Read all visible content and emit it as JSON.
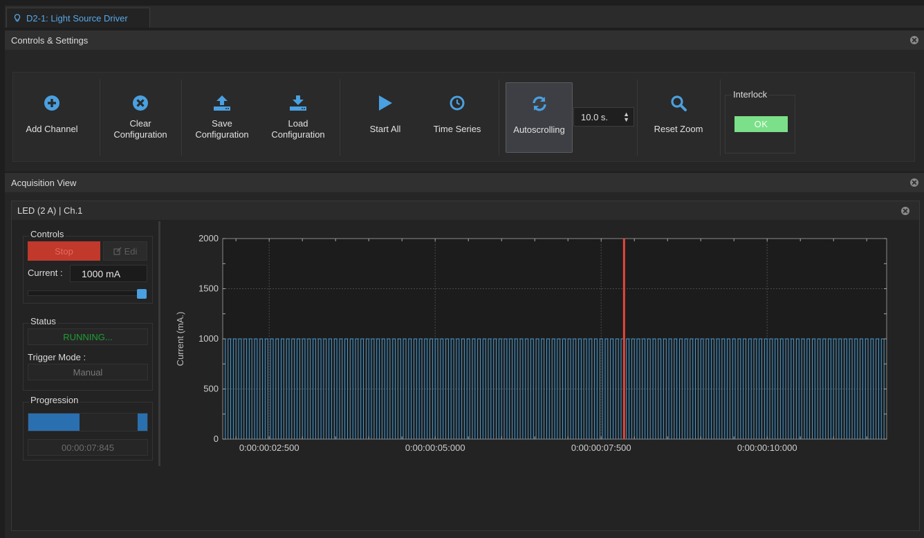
{
  "tab": {
    "title": "D2-1: Light Source Driver",
    "icon": "lightbulb-icon"
  },
  "controls_section": {
    "title": "Controls & Settings"
  },
  "toolbar": {
    "add_channel": "Add Channel",
    "clear_configuration": "Clear\nConfiguration",
    "save_configuration": "Save\nConfiguration",
    "load_configuration": "Load\nConfiguration",
    "start_all": "Start All",
    "time_series": "Time Series",
    "autoscrolling": "Autoscrolling",
    "scroll_window": "10.0 s.",
    "reset_zoom": "Reset Zoom",
    "interlock_label": "Interlock",
    "interlock_status": "OK"
  },
  "acquisition_section": {
    "title": "Acquisition View"
  },
  "channel": {
    "title": "LED (2 A) | Ch.1",
    "controls_label": "Controls",
    "stop_label": "Stop",
    "edit_label": "Edi",
    "current_label": "Current :",
    "current_value": "1000 mA",
    "current_slider_fraction": 1.0,
    "status_label": "Status",
    "status_value": "RUNNING...",
    "trigger_label": "Trigger Mode :",
    "trigger_value": "Manual",
    "progression_label": "Progression",
    "progress_fraction": 0.43,
    "elapsed_time": "00:00:07:845"
  },
  "colors": {
    "accent": "#4aa0e0",
    "stop": "#c0392b",
    "running": "#1e9e35",
    "ok": "#7be089",
    "marker": "#e8463a"
  },
  "chart_data": {
    "type": "line",
    "title": "",
    "xlabel": "",
    "ylabel": "Current (mA.)",
    "ylim": [
      0,
      2000
    ],
    "yticks": [
      "0",
      "500",
      "1000",
      "1500",
      "2000"
    ],
    "xticks": [
      "0:00:00:02:500",
      "0:00:00:05:000",
      "0:00:00:07:500",
      "0:00:00:10:000"
    ],
    "xlim_seconds": [
      1.8,
      11.8
    ],
    "xtick_seconds": [
      2.5,
      5.0,
      7.5,
      10.0
    ],
    "grid": true,
    "series": [
      {
        "waveform": "square",
        "high": 1000,
        "low": 0,
        "period_seconds": 0.08,
        "duty": 0.5,
        "color": "#4a9fd8"
      }
    ],
    "cursor_seconds": 7.845,
    "cursor_color": "#e8463a"
  }
}
